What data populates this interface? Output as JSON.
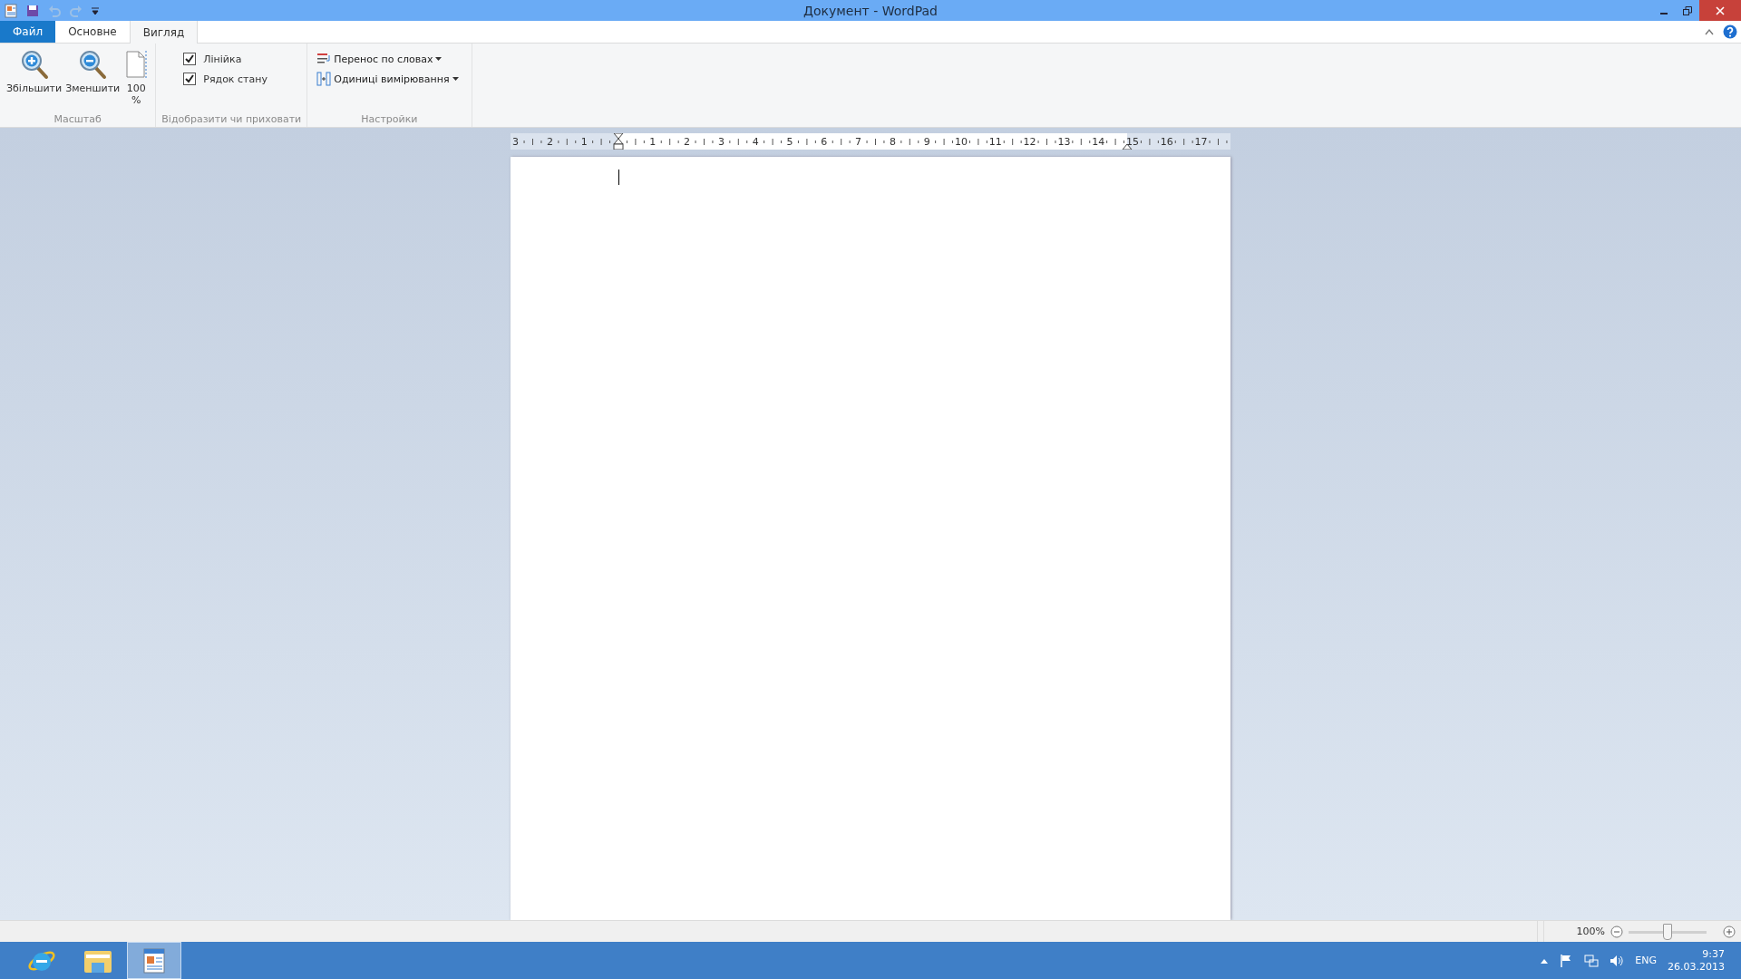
{
  "window": {
    "title": "Документ - WordPad"
  },
  "tabs": [
    {
      "label": "Файл",
      "kind": "file",
      "selected": false
    },
    {
      "label": "Основне",
      "kind": "tab",
      "selected": false
    },
    {
      "label": "Вигляд",
      "kind": "tab",
      "selected": true
    }
  ],
  "ribbon": {
    "groups": [
      {
        "title": "Масштаб",
        "kind": "zoom",
        "buttons": [
          {
            "label": "Збільшити",
            "kind": "zoom-in"
          },
          {
            "label": "Зменшити",
            "kind": "zoom-out"
          },
          {
            "label": "100\n%",
            "kind": "page"
          }
        ]
      },
      {
        "title": "Відобразити чи приховати",
        "kind": "checks",
        "items": [
          {
            "label": "Лінійка",
            "checked": true
          },
          {
            "label": "Рядок стану",
            "checked": true
          }
        ]
      },
      {
        "title": "Настройки",
        "kind": "menus",
        "items": [
          {
            "label": "Перенос по словах",
            "kind": "wrap"
          },
          {
            "label": "Одиниці вимірювання",
            "kind": "units"
          }
        ]
      }
    ]
  },
  "ruler": {
    "left_labels": [
      "3",
      "2",
      "1"
    ],
    "right_labels": [
      "1",
      "2",
      "3",
      "4",
      "5",
      "6",
      "7",
      "8",
      "9",
      "10",
      "11",
      "12",
      "13",
      "14",
      "15",
      "16",
      "17"
    ]
  },
  "status_bar": {
    "zoom": "100%",
    "level": 0.5
  },
  "taskbar": {
    "language": "ENG",
    "time": "9:37",
    "date": "26.03.2013"
  }
}
